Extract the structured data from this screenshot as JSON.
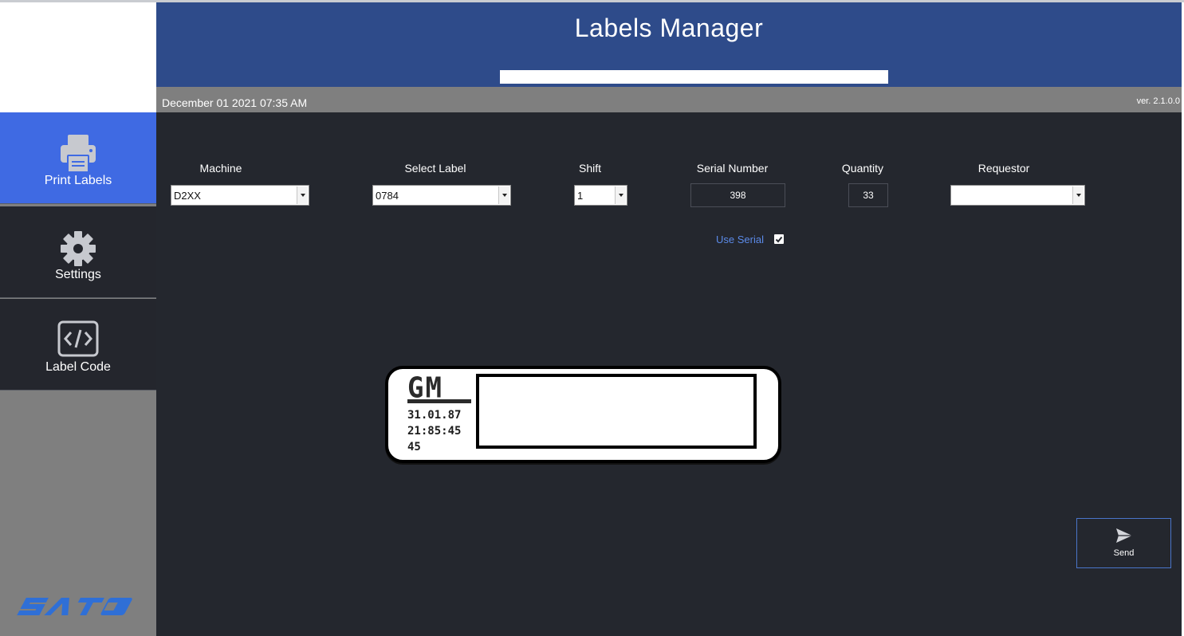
{
  "app": {
    "title": "Labels  Manager",
    "date_time": "December 01 2021 07:35 AM",
    "version": "ver. 2.1.0.0"
  },
  "sidebar": {
    "items": [
      {
        "label": "Print Labels",
        "icon": "printer-icon",
        "active": true
      },
      {
        "label": "Settings",
        "icon": "gear-icon",
        "active": false
      },
      {
        "label": "Label Code",
        "icon": "code-icon",
        "active": false
      }
    ],
    "brand_logo": "SATO"
  },
  "form": {
    "machine": {
      "label": "Machine",
      "value": "D2XX"
    },
    "select_label": {
      "label": "Select Label",
      "value": "0784"
    },
    "shift": {
      "label": "Shift",
      "value": "1"
    },
    "serial_number": {
      "label": "Serial Number",
      "value": "398"
    },
    "quantity": {
      "label": "Quantity",
      "value": "33"
    },
    "requestor": {
      "label": "Requestor",
      "value": ""
    },
    "use_serial": {
      "label": "Use Serial",
      "checked": true
    }
  },
  "preview": {
    "brand": "GM",
    "lines": [
      "31.01.87",
      "21:85:45",
      "45"
    ]
  },
  "actions": {
    "send_label": "Send"
  },
  "colors": {
    "header": "#2e4b8a",
    "active_nav": "#3f6ae3",
    "main_bg": "#24272e",
    "status_bar": "#7f7f7f",
    "accent_link": "#5b8ae8",
    "send_border": "#4a75c9"
  }
}
